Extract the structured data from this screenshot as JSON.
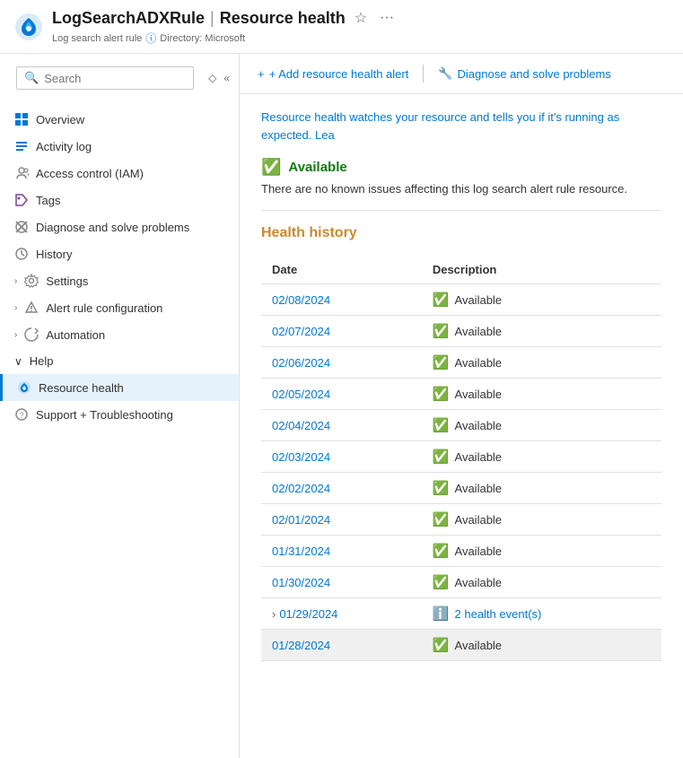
{
  "header": {
    "resource_name": "LogSearchADXRule",
    "separator": "|",
    "page_title": "Resource health",
    "subtitle_type": "Log search alert rule",
    "info_icon_label": "info",
    "directory_label": "Directory: Microsoft"
  },
  "search": {
    "placeholder": "Search",
    "collapse_icon": "«",
    "filter_icon": "◇"
  },
  "sidebar": {
    "items": [
      {
        "id": "overview",
        "label": "Overview",
        "icon": "■",
        "icon_color": "#0078d4",
        "expandable": false,
        "active": false
      },
      {
        "id": "activity-log",
        "label": "Activity log",
        "icon": "≡",
        "icon_color": "#0078d4",
        "expandable": false,
        "active": false
      },
      {
        "id": "access-control",
        "label": "Access control (IAM)",
        "icon": "👤",
        "icon_color": "#888",
        "expandable": false,
        "active": false
      },
      {
        "id": "tags",
        "label": "Tags",
        "icon": "⬡",
        "icon_color": "#7a4299",
        "expandable": false,
        "active": false
      },
      {
        "id": "diagnose",
        "label": "Diagnose and solve problems",
        "icon": "✕",
        "icon_color": "#888",
        "expandable": false,
        "active": false
      },
      {
        "id": "history",
        "label": "History",
        "icon": "⊙",
        "icon_color": "#888",
        "expandable": false,
        "active": false
      },
      {
        "id": "settings",
        "label": "Settings",
        "icon": "›",
        "icon_color": "#888",
        "expandable": true,
        "active": false
      },
      {
        "id": "alert-rule",
        "label": "Alert rule configuration",
        "icon": "›",
        "icon_color": "#888",
        "expandable": true,
        "active": false
      },
      {
        "id": "automation",
        "label": "Automation",
        "icon": "›",
        "icon_color": "#888",
        "expandable": true,
        "active": false
      }
    ],
    "help_group": {
      "label": "Help",
      "expanded": true,
      "sub_items": [
        {
          "id": "resource-health",
          "label": "Resource health",
          "icon": "❤",
          "icon_color": "#0078d4",
          "active": true
        },
        {
          "id": "support",
          "label": "Support + Troubleshooting",
          "icon": "?",
          "icon_color": "#888",
          "active": false
        }
      ]
    }
  },
  "toolbar": {
    "add_alert_label": "+ Add resource health alert",
    "diagnose_label": "Diagnose and solve problems"
  },
  "content": {
    "description": "Resource health watches your resource and tells you if it's running as expected. Lea",
    "current_status": {
      "label": "Available",
      "message": "There are no known issues affecting this log search alert rule resource."
    },
    "health_history_title": "Health history",
    "table": {
      "columns": [
        {
          "id": "date",
          "label": "Date"
        },
        {
          "id": "description",
          "label": "Description"
        }
      ],
      "rows": [
        {
          "date": "02/08/2024",
          "status": "Available",
          "type": "available",
          "expandable": false
        },
        {
          "date": "02/07/2024",
          "status": "Available",
          "type": "available",
          "expandable": false
        },
        {
          "date": "02/06/2024",
          "status": "Available",
          "type": "available",
          "expandable": false
        },
        {
          "date": "02/05/2024",
          "status": "Available",
          "type": "available",
          "expandable": false
        },
        {
          "date": "02/04/2024",
          "status": "Available",
          "type": "available",
          "expandable": false
        },
        {
          "date": "02/03/2024",
          "status": "Available",
          "type": "available",
          "expandable": false
        },
        {
          "date": "02/02/2024",
          "status": "Available",
          "type": "available",
          "expandable": false
        },
        {
          "date": "02/01/2024",
          "status": "Available",
          "type": "available",
          "expandable": false
        },
        {
          "date": "01/31/2024",
          "status": "Available",
          "type": "available",
          "expandable": false
        },
        {
          "date": "01/30/2024",
          "status": "Available",
          "type": "available",
          "expandable": false
        },
        {
          "date": "01/29/2024",
          "status": "2 health event(s)",
          "type": "events",
          "expandable": true
        },
        {
          "date": "01/28/2024",
          "status": "Available",
          "type": "available",
          "expandable": false,
          "highlighted": true
        }
      ]
    }
  }
}
